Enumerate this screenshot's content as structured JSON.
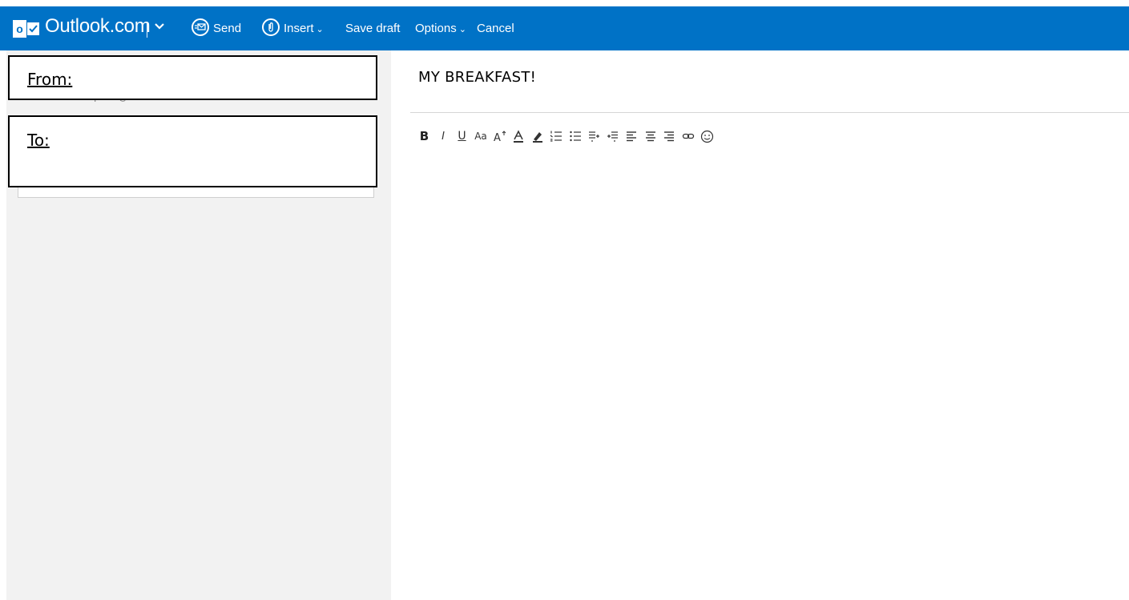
{
  "header": {
    "brand": "Outlook.com",
    "logo_letter": "o",
    "send_label": "Send",
    "insert_label": "Insert",
    "save_draft_label": "Save draft",
    "options_label": "Options",
    "cancel_label": "Cancel",
    "colors": {
      "bar": "#0072c6",
      "text": "#ffffff"
    }
  },
  "compose": {
    "from_label": "From:",
    "from_address": "ericatorresperez@hotmail.com",
    "to_label": "To:",
    "subject": "MY BREAKFAST!"
  },
  "toolbar": {
    "bold": "B",
    "italic": "I",
    "underline": "U",
    "font_size": "Aa",
    "icons": [
      "bold-icon",
      "italic-icon",
      "underline-icon",
      "font-size-icon",
      "grow-font-icon",
      "font-color-icon",
      "highlight-icon",
      "numbered-list-icon",
      "bullet-list-icon",
      "decrease-indent-icon",
      "increase-indent-icon",
      "align-left-icon",
      "align-center-icon",
      "align-right-icon",
      "link-icon",
      "emoticon-icon"
    ]
  }
}
